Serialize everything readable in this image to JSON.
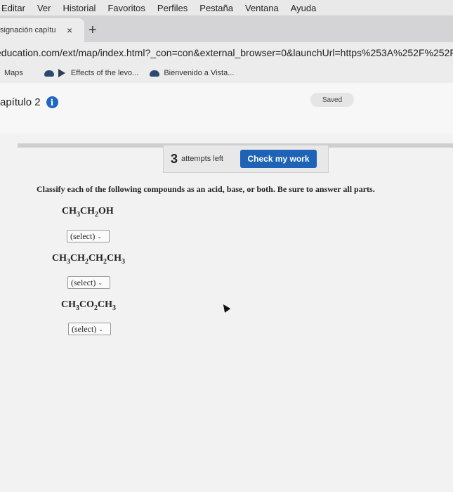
{
  "menubar": [
    "Editar",
    "Ver",
    "Historial",
    "Favoritos",
    "Perfiles",
    "Pestaña",
    "Ventana",
    "Ayuda"
  ],
  "tab": {
    "title": "signación capítu",
    "close": "×",
    "new": "+"
  },
  "address": {
    "url": "education.com/ext/map/index.html?_con=con&external_browser=0&launchUrl=https%253A%252F%252F"
  },
  "bookmarks": [
    {
      "label": "Maps",
      "icon": "cloud-icon"
    },
    {
      "label": "Effects of the levo...",
      "icon": "play-icon"
    },
    {
      "label": "Bienvenido a Vista...",
      "icon": "cloud-icon"
    }
  ],
  "header": {
    "chapter": "apítulo 2",
    "info": "i",
    "saved": "Saved"
  },
  "attempts": {
    "count": "3",
    "label": "attempts left",
    "check": "Check my work"
  },
  "question": "Classify each of the following compounds as an acid, base, or both. Be sure to answer all parts.",
  "compounds": [
    {
      "parts": [
        "CH",
        "3",
        "CH",
        "2",
        "OH",
        ""
      ],
      "select": "(select)"
    },
    {
      "parts": [
        "CH",
        "3",
        "CH",
        "2",
        "CH",
        "2",
        "CH",
        "3"
      ],
      "select": "(select)"
    },
    {
      "parts": [
        "CH",
        "3",
        "CO",
        "2",
        "CH",
        "3"
      ],
      "select": "(select)"
    }
  ],
  "colors": {
    "accent": "#1f63b6",
    "info": "#1f66c4"
  }
}
